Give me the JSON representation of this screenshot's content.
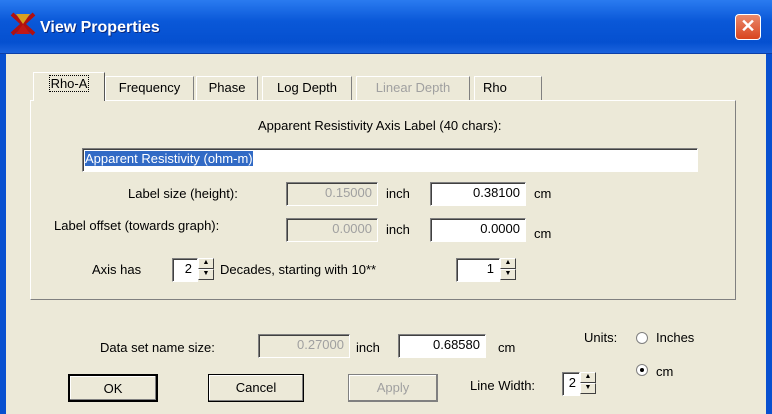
{
  "window": {
    "title": "View Properties",
    "close_glyph": "✕"
  },
  "tabs": [
    {
      "label": "Rho-A",
      "active": true,
      "enabled": true
    },
    {
      "label": "Frequency",
      "enabled": true
    },
    {
      "label": "Phase",
      "enabled": true
    },
    {
      "label": "Log Depth",
      "enabled": true
    },
    {
      "label": "Linear Depth",
      "enabled": false
    },
    {
      "label": "Rho",
      "enabled": true
    }
  ],
  "panel": {
    "axis_label_caption": "Apparent Resistivity Axis Label (40 chars):",
    "axis_label_value": "Apparent Resistivity (ohm-m)",
    "label_size": {
      "caption": "Label size (height):",
      "inch": "0.15000",
      "inch_unit": "inch",
      "cm": "0.38100",
      "cm_unit": "cm"
    },
    "label_offset": {
      "caption": "Label offset (towards graph):",
      "inch": "0.0000",
      "inch_unit": "inch",
      "cm": "0.0000",
      "cm_unit": "cm"
    },
    "axis_has": {
      "caption": "Axis has",
      "decades": "2",
      "decades_caption": "Decades, starting with 10**",
      "start": "1"
    }
  },
  "bottom": {
    "dataset_size": {
      "caption": "Data set name size:",
      "inch": "0.27000",
      "inch_unit": "inch",
      "cm": "0.68580",
      "cm_unit": "cm"
    },
    "units": {
      "caption": "Units:",
      "options": [
        "Inches",
        "cm"
      ],
      "selected": "cm"
    },
    "line_width": {
      "caption": "Line Width:",
      "value": "2"
    },
    "buttons": {
      "ok": "OK",
      "cancel": "Cancel",
      "apply": "Apply"
    }
  }
}
